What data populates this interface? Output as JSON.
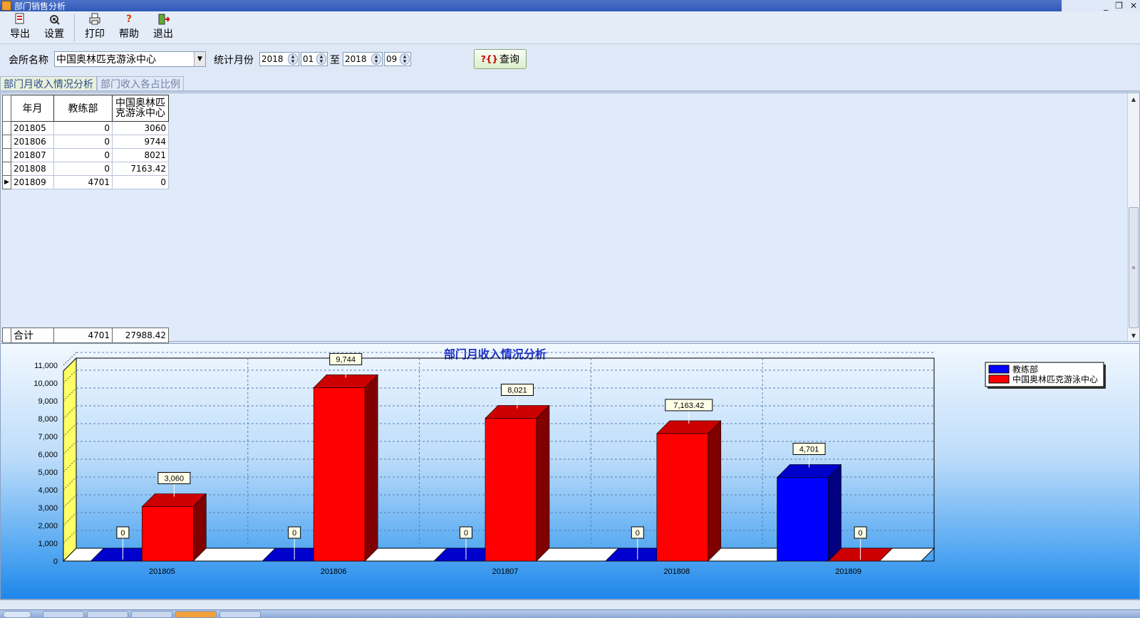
{
  "window": {
    "title": "部门销售分析",
    "controls": [
      "_",
      "❐",
      "✕"
    ]
  },
  "toolbar": {
    "export_label": "导出",
    "settings_label": "设置",
    "print_label": "打印",
    "help_label": "帮助",
    "exit_label": "退出"
  },
  "filters": {
    "club_label": "会所名称",
    "club_value": "中国奥林匹克游泳中心",
    "month_label": "统计月份",
    "from_year": "2018",
    "from_month": "01",
    "to_label": "至",
    "to_year": "2018",
    "to_month": "09",
    "query_label": "查询"
  },
  "tabs": [
    "部门月收入情况分析",
    "部门收入各占比例"
  ],
  "grid": {
    "columns": [
      "年月",
      "教练部",
      "中国奥林匹克游泳中心"
    ],
    "column3_line1": "中国奥林匹",
    "column3_line2": "克游泳中心",
    "rows": [
      {
        "month": "201805",
        "coach": "0",
        "center": "3060"
      },
      {
        "month": "201806",
        "coach": "0",
        "center": "9744"
      },
      {
        "month": "201807",
        "coach": "0",
        "center": "8021"
      },
      {
        "month": "201808",
        "coach": "0",
        "center": "7163.42"
      },
      {
        "month": "201809",
        "coach": "4701",
        "center": "0"
      }
    ],
    "total_label": "合计",
    "total_coach": "4701",
    "total_center": "27988.42"
  },
  "chart_data": {
    "type": "bar",
    "title": "部门月收入情况分析",
    "categories": [
      "201805",
      "201806",
      "201807",
      "201808",
      "201809"
    ],
    "series": [
      {
        "name": "教练部",
        "values": [
          0,
          0,
          0,
          0,
          4701
        ],
        "labels": [
          "0",
          "0",
          "0",
          "0",
          "4,701"
        ],
        "color": "#0000ff"
      },
      {
        "name": "中国奥林匹克游泳中心",
        "values": [
          3060,
          9744,
          8021,
          7163.42,
          0
        ],
        "labels": [
          "3,060",
          "9,744",
          "8,021",
          "7,163.42",
          "0"
        ],
        "color": "#ff0000"
      }
    ],
    "ylim": [
      0,
      11000
    ],
    "yticks": [
      "0",
      "1,000",
      "2,000",
      "3,000",
      "4,000",
      "5,000",
      "6,000",
      "7,000",
      "8,000",
      "9,000",
      "10,000",
      "11,000"
    ],
    "legend_position": "top-right",
    "grid": true,
    "style": "3d"
  }
}
